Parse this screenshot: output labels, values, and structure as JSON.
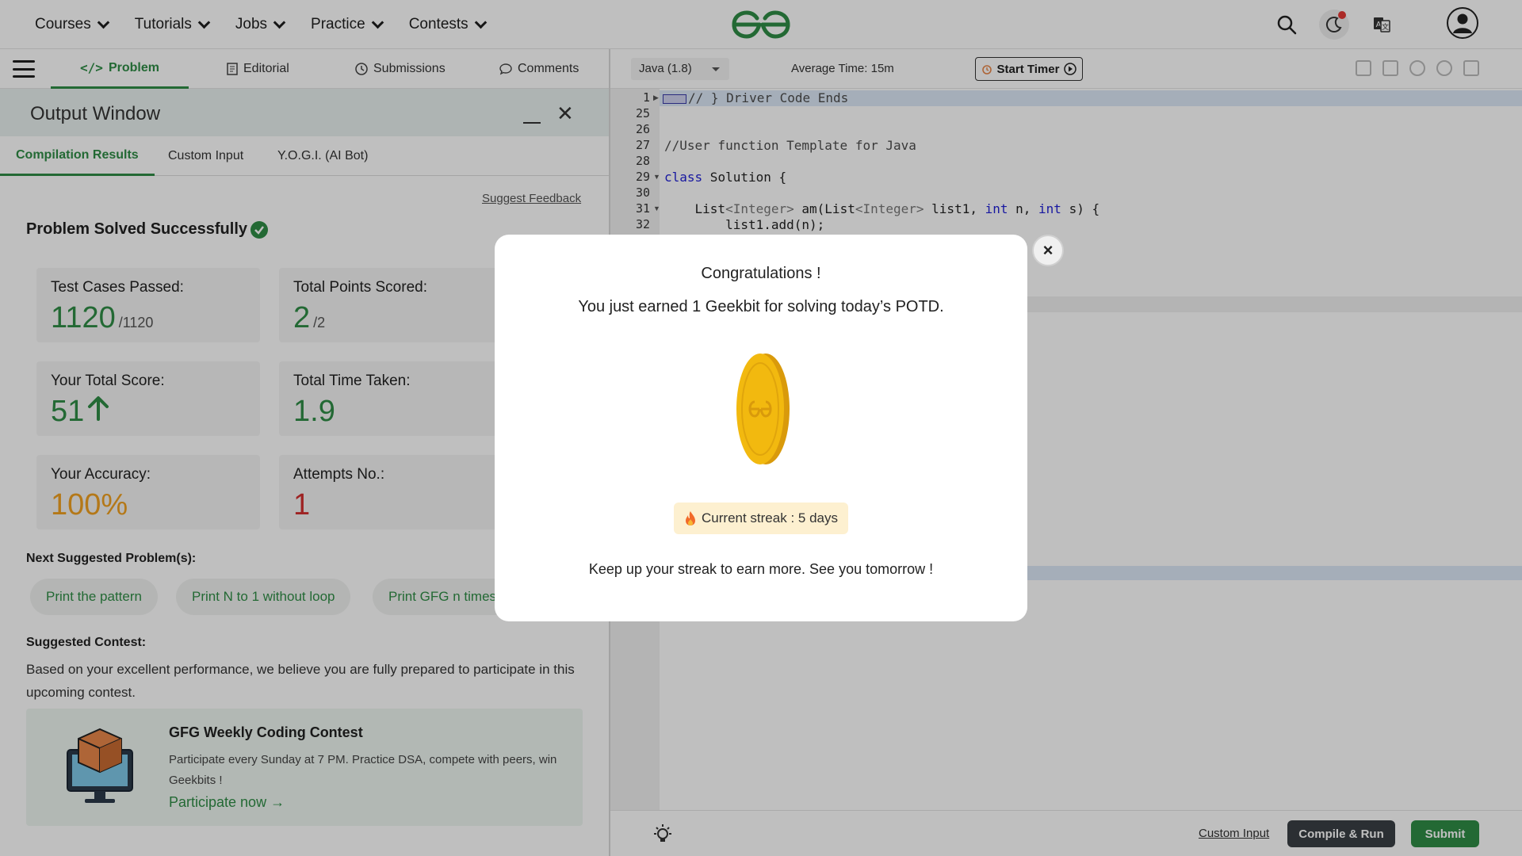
{
  "nav": {
    "items": [
      "Courses",
      "Tutorials",
      "Jobs",
      "Practice",
      "Contests"
    ]
  },
  "left_tabs": {
    "problem": "Problem",
    "editorial": "Editorial",
    "submissions": "Submissions",
    "comments": "Comments"
  },
  "output_window": {
    "title": "Output Window",
    "tabs": [
      "Compilation Results",
      "Custom Input",
      "Y.O.G.I. (AI Bot)"
    ],
    "suggest_feedback": "Suggest Feedback",
    "status": "Problem Solved Successfully",
    "stats": {
      "test_cases_label": "Test Cases Passed:",
      "test_cases_value": "1120",
      "test_cases_total": "/1120",
      "points_label": "Total Points Scored:",
      "points_value": "2",
      "points_total": "/2",
      "score_label": "Your Total Score:",
      "score_value": "51",
      "time_label": "Total Time Taken:",
      "time_value": "1.9",
      "accuracy_label": "Your Accuracy:",
      "accuracy_value": "100%",
      "attempts_label": "Attempts No.:",
      "attempts_value": "1"
    },
    "next_suggested_label": "Next Suggested Problem(s):",
    "suggested_problems": [
      "Print the pattern",
      "Print N to 1 without loop",
      "Print GFG n times"
    ],
    "suggested_contest_label": "Suggested Contest:",
    "contest_desc": "Based on your excellent performance, we believe you are fully prepared to participate in this upcoming contest.",
    "contest": {
      "title": "GFG Weekly Coding Contest",
      "body": "Participate every Sunday at 7 PM. Practice DSA, compete with peers, win Geekbits !",
      "link": "Participate now"
    }
  },
  "editor": {
    "language": "Java (1.8)",
    "avg_time": "Average Time: 15m",
    "start_timer": "Start Timer",
    "line_numbers": [
      "1",
      "25",
      "26",
      "27",
      "28",
      "29",
      "30",
      "31",
      "32"
    ],
    "lines": {
      "l1": "// } Driver Code Ends",
      "l27": "//User function Template for Java",
      "l29_kw": "class",
      "l29_rest": " Solution {",
      "l31_a": "    List",
      "l31_b": "<Integer>",
      "l31_c": " am(List",
      "l31_d": "<Integer>",
      "l31_e": " list1, ",
      "l31_f": "int",
      "l31_g": " n, ",
      "l31_h": "int",
      "l31_i": " s) {",
      "l32": "        list1.add(n);"
    },
    "custom_input": "Custom Input",
    "compile_run": "Compile & Run",
    "submit": "Submit"
  },
  "modal": {
    "title": "Congratulations !",
    "subtitle": "You just earned 1 Geekbit for solving today’s POTD.",
    "streak": "Current streak : 5 days",
    "footer": "Keep up your streak to earn more. See you tomorrow !",
    "close": "×"
  },
  "colors": {
    "brand_green": "#2f8d46",
    "accuracy_orange": "#f0a020",
    "attempts_red": "#d32f2f",
    "coin_gold": "#f2b90f"
  }
}
